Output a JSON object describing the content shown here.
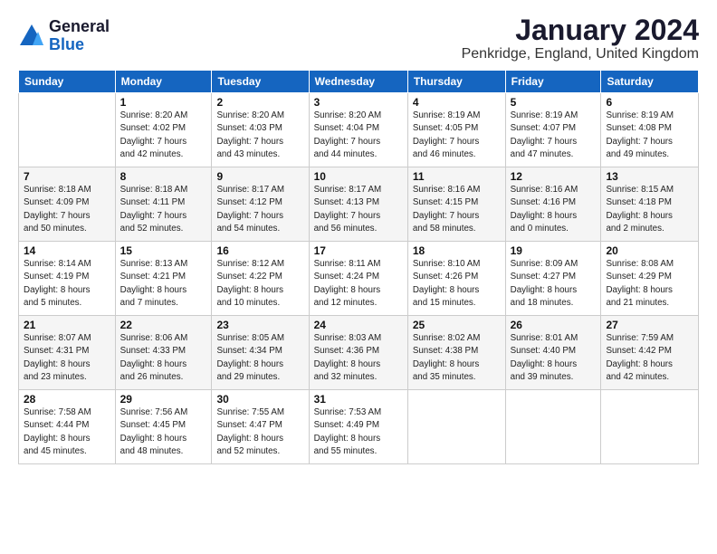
{
  "logo": {
    "general": "General",
    "blue": "Blue"
  },
  "header": {
    "month": "January 2024",
    "location": "Penkridge, England, United Kingdom"
  },
  "days_of_week": [
    "Sunday",
    "Monday",
    "Tuesday",
    "Wednesday",
    "Thursday",
    "Friday",
    "Saturday"
  ],
  "weeks": [
    [
      {
        "day": "",
        "info": ""
      },
      {
        "day": "1",
        "info": "Sunrise: 8:20 AM\nSunset: 4:02 PM\nDaylight: 7 hours\nand 42 minutes."
      },
      {
        "day": "2",
        "info": "Sunrise: 8:20 AM\nSunset: 4:03 PM\nDaylight: 7 hours\nand 43 minutes."
      },
      {
        "day": "3",
        "info": "Sunrise: 8:20 AM\nSunset: 4:04 PM\nDaylight: 7 hours\nand 44 minutes."
      },
      {
        "day": "4",
        "info": "Sunrise: 8:19 AM\nSunset: 4:05 PM\nDaylight: 7 hours\nand 46 minutes."
      },
      {
        "day": "5",
        "info": "Sunrise: 8:19 AM\nSunset: 4:07 PM\nDaylight: 7 hours\nand 47 minutes."
      },
      {
        "day": "6",
        "info": "Sunrise: 8:19 AM\nSunset: 4:08 PM\nDaylight: 7 hours\nand 49 minutes."
      }
    ],
    [
      {
        "day": "7",
        "info": "Sunrise: 8:18 AM\nSunset: 4:09 PM\nDaylight: 7 hours\nand 50 minutes."
      },
      {
        "day": "8",
        "info": "Sunrise: 8:18 AM\nSunset: 4:11 PM\nDaylight: 7 hours\nand 52 minutes."
      },
      {
        "day": "9",
        "info": "Sunrise: 8:17 AM\nSunset: 4:12 PM\nDaylight: 7 hours\nand 54 minutes."
      },
      {
        "day": "10",
        "info": "Sunrise: 8:17 AM\nSunset: 4:13 PM\nDaylight: 7 hours\nand 56 minutes."
      },
      {
        "day": "11",
        "info": "Sunrise: 8:16 AM\nSunset: 4:15 PM\nDaylight: 7 hours\nand 58 minutes."
      },
      {
        "day": "12",
        "info": "Sunrise: 8:16 AM\nSunset: 4:16 PM\nDaylight: 8 hours\nand 0 minutes."
      },
      {
        "day": "13",
        "info": "Sunrise: 8:15 AM\nSunset: 4:18 PM\nDaylight: 8 hours\nand 2 minutes."
      }
    ],
    [
      {
        "day": "14",
        "info": "Sunrise: 8:14 AM\nSunset: 4:19 PM\nDaylight: 8 hours\nand 5 minutes."
      },
      {
        "day": "15",
        "info": "Sunrise: 8:13 AM\nSunset: 4:21 PM\nDaylight: 8 hours\nand 7 minutes."
      },
      {
        "day": "16",
        "info": "Sunrise: 8:12 AM\nSunset: 4:22 PM\nDaylight: 8 hours\nand 10 minutes."
      },
      {
        "day": "17",
        "info": "Sunrise: 8:11 AM\nSunset: 4:24 PM\nDaylight: 8 hours\nand 12 minutes."
      },
      {
        "day": "18",
        "info": "Sunrise: 8:10 AM\nSunset: 4:26 PM\nDaylight: 8 hours\nand 15 minutes."
      },
      {
        "day": "19",
        "info": "Sunrise: 8:09 AM\nSunset: 4:27 PM\nDaylight: 8 hours\nand 18 minutes."
      },
      {
        "day": "20",
        "info": "Sunrise: 8:08 AM\nSunset: 4:29 PM\nDaylight: 8 hours\nand 21 minutes."
      }
    ],
    [
      {
        "day": "21",
        "info": "Sunrise: 8:07 AM\nSunset: 4:31 PM\nDaylight: 8 hours\nand 23 minutes."
      },
      {
        "day": "22",
        "info": "Sunrise: 8:06 AM\nSunset: 4:33 PM\nDaylight: 8 hours\nand 26 minutes."
      },
      {
        "day": "23",
        "info": "Sunrise: 8:05 AM\nSunset: 4:34 PM\nDaylight: 8 hours\nand 29 minutes."
      },
      {
        "day": "24",
        "info": "Sunrise: 8:03 AM\nSunset: 4:36 PM\nDaylight: 8 hours\nand 32 minutes."
      },
      {
        "day": "25",
        "info": "Sunrise: 8:02 AM\nSunset: 4:38 PM\nDaylight: 8 hours\nand 35 minutes."
      },
      {
        "day": "26",
        "info": "Sunrise: 8:01 AM\nSunset: 4:40 PM\nDaylight: 8 hours\nand 39 minutes."
      },
      {
        "day": "27",
        "info": "Sunrise: 7:59 AM\nSunset: 4:42 PM\nDaylight: 8 hours\nand 42 minutes."
      }
    ],
    [
      {
        "day": "28",
        "info": "Sunrise: 7:58 AM\nSunset: 4:44 PM\nDaylight: 8 hours\nand 45 minutes."
      },
      {
        "day": "29",
        "info": "Sunrise: 7:56 AM\nSunset: 4:45 PM\nDaylight: 8 hours\nand 48 minutes."
      },
      {
        "day": "30",
        "info": "Sunrise: 7:55 AM\nSunset: 4:47 PM\nDaylight: 8 hours\nand 52 minutes."
      },
      {
        "day": "31",
        "info": "Sunrise: 7:53 AM\nSunset: 4:49 PM\nDaylight: 8 hours\nand 55 minutes."
      },
      {
        "day": "",
        "info": ""
      },
      {
        "day": "",
        "info": ""
      },
      {
        "day": "",
        "info": ""
      }
    ]
  ]
}
